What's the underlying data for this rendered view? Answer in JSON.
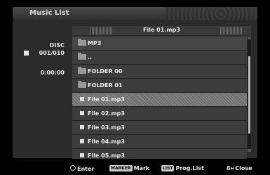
{
  "window": {
    "title": "Music List"
  },
  "left": {
    "disc_label": "DISC",
    "track_count": "001/010",
    "time": "0:00:00"
  },
  "header": {
    "current_file": "File 01.mp3"
  },
  "list": {
    "items": [
      {
        "label": "MP3",
        "icon": "folder-icon",
        "style": "mid"
      },
      {
        "label": "..",
        "icon": "folder-up-icon",
        "style": "dark"
      },
      {
        "label": "FOLDER 00",
        "icon": "folder-icon",
        "style": "dark"
      },
      {
        "label": "FOLDER 01",
        "icon": "folder-icon",
        "style": "dark"
      },
      {
        "label": "File 01.mp3",
        "icon": "music-file-icon",
        "style": "selected"
      },
      {
        "label": "File 02.mp3",
        "icon": "music-file-icon",
        "style": "dark"
      },
      {
        "label": "File 03.mp3",
        "icon": "music-file-icon",
        "style": "dark"
      },
      {
        "label": "File 04.mp3",
        "icon": "music-file-icon",
        "style": "dark"
      },
      {
        "label": "File 05.mp3",
        "icon": "music-file-icon",
        "style": "dark"
      }
    ]
  },
  "footer": {
    "enter_label": "Enter",
    "marker_key": "MARKER",
    "mark_label": "Mark",
    "list_key": "LIST",
    "prog_label": "Prog.List",
    "close_symbol": "δ↵",
    "close_label": "Close"
  }
}
